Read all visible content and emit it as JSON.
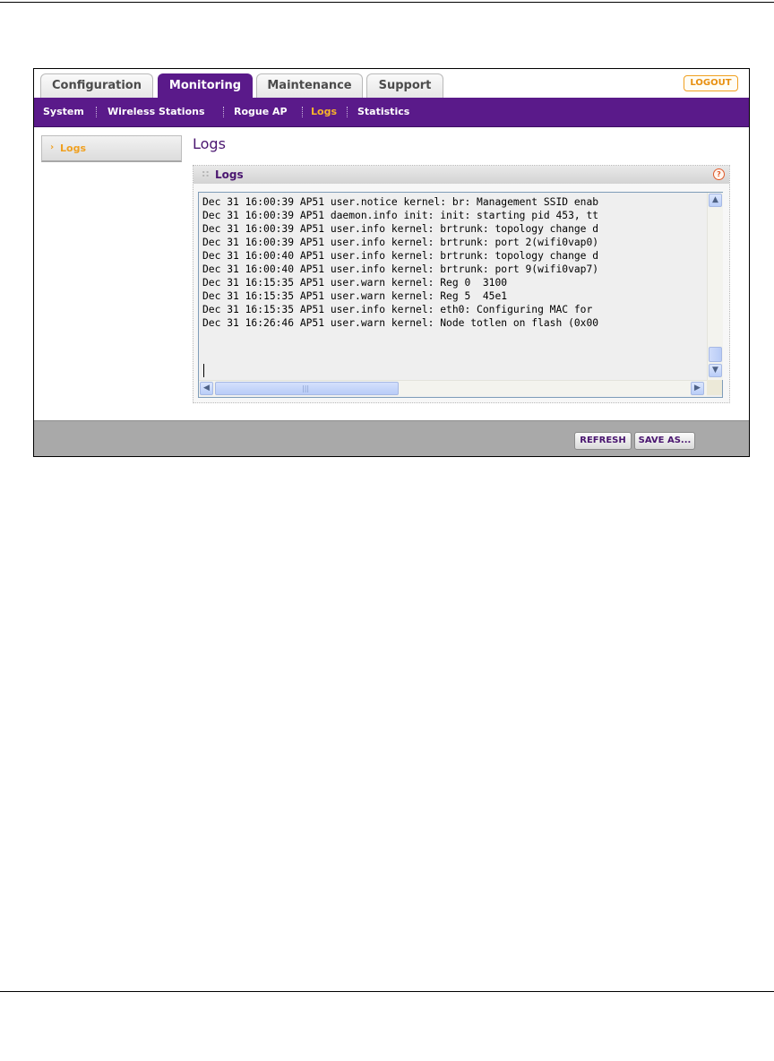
{
  "tabs": [
    {
      "label": "Configuration",
      "active": false
    },
    {
      "label": "Monitoring",
      "active": true
    },
    {
      "label": "Maintenance",
      "active": false
    },
    {
      "label": "Support",
      "active": false
    }
  ],
  "logout_label": "LOGOUT",
  "subnav": [
    {
      "label": "System",
      "active": false
    },
    {
      "label": "Wireless Stations",
      "active": false
    },
    {
      "label": "Rogue AP",
      "active": false
    },
    {
      "label": "Logs",
      "active": true
    },
    {
      "label": "Statistics",
      "active": false
    }
  ],
  "leftnav": {
    "label": "Logs",
    "arrow": "›"
  },
  "page_title": "Logs",
  "panel": {
    "title": "Logs",
    "help_icon": "?"
  },
  "log_lines": [
    "Dec 31 16:00:39 AP51 user.notice kernel: br: Management SSID enab",
    "Dec 31 16:00:39 AP51 daemon.info init: init: starting pid 453, tt",
    "Dec 31 16:00:39 AP51 user.info kernel: brtrunk: topology change d",
    "Dec 31 16:00:39 AP51 user.info kernel: brtrunk: port 2(wifi0vap0)",
    "Dec 31 16:00:40 AP51 user.info kernel: brtrunk: topology change d",
    "Dec 31 16:00:40 AP51 user.info kernel: brtrunk: port 9(wifi0vap7)",
    "Dec 31 16:15:35 AP51 user.warn kernel: Reg 0  3100",
    "Dec 31 16:15:35 AP51 user.warn kernel: Reg 5  45e1",
    "Dec 31 16:15:35 AP51 user.info kernel: eth0: Configuring MAC for",
    "Dec 31 16:26:46 AP51 user.warn kernel: Node totlen on flash (0x00"
  ],
  "buttons": {
    "refresh": "REFRESH",
    "save_as": "SAVE AS..."
  },
  "colors": {
    "brand_purple": "#5a1a8a",
    "accent_orange": "#f0a020"
  }
}
